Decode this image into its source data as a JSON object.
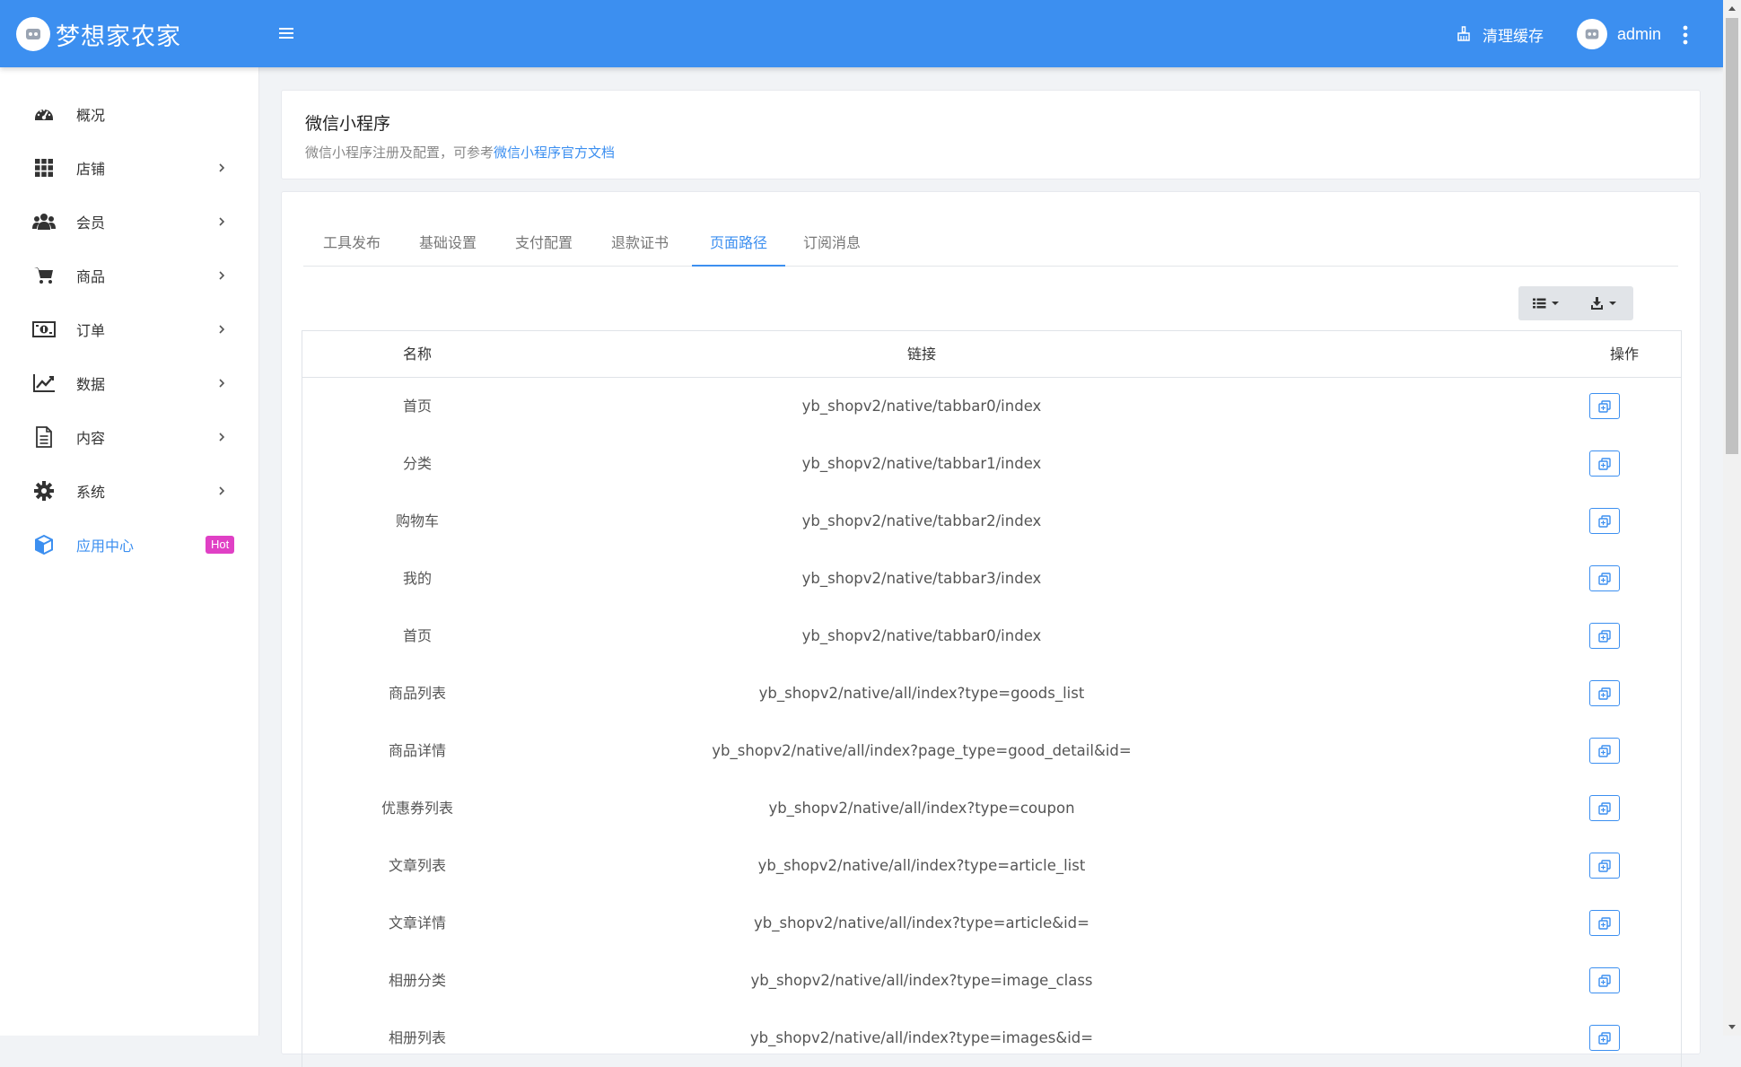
{
  "header": {
    "brand_title": "梦想家农家",
    "clear_cache_label": "清理缓存",
    "user_name": "admin",
    "accent_color": "#3c8ff0"
  },
  "sidebar": {
    "items": [
      {
        "label": "概况",
        "icon": "dashboard-icon"
      },
      {
        "label": "店铺",
        "icon": "grid-icon"
      },
      {
        "label": "会员",
        "icon": "users-icon"
      },
      {
        "label": "商品",
        "icon": "cart-icon"
      },
      {
        "label": "订单",
        "icon": "money-icon"
      },
      {
        "label": "数据",
        "icon": "chart-line-icon"
      },
      {
        "label": "内容",
        "icon": "document-icon"
      },
      {
        "label": "系统",
        "icon": "gear-icon"
      },
      {
        "label": "应用中心",
        "icon": "cube-icon",
        "badge": "Hot",
        "active": true
      }
    ]
  },
  "info": {
    "title": "微信小程序",
    "desc_prefix": "微信小程序注册及配置，可参考",
    "desc_link": "微信小程序官方文档"
  },
  "tabs": [
    {
      "label": "工具发布"
    },
    {
      "label": "基础设置"
    },
    {
      "label": "支付配置"
    },
    {
      "label": "退款证书"
    },
    {
      "label": "页面路径",
      "active": true
    },
    {
      "label": "订阅消息"
    }
  ],
  "table": {
    "headers": {
      "name": "名称",
      "link": "链接",
      "op": "操作"
    },
    "rows": [
      {
        "name": "首页",
        "link": "yb_shopv2/native/tabbar0/index"
      },
      {
        "name": "分类",
        "link": "yb_shopv2/native/tabbar1/index"
      },
      {
        "name": "购物车",
        "link": "yb_shopv2/native/tabbar2/index"
      },
      {
        "name": "我的",
        "link": "yb_shopv2/native/tabbar3/index"
      },
      {
        "name": "首页",
        "link": "yb_shopv2/native/tabbar0/index"
      },
      {
        "name": "商品列表",
        "link": "yb_shopv2/native/all/index?type=goods_list"
      },
      {
        "name": "商品详情",
        "link": "yb_shopv2/native/all/index?page_type=good_detail&id="
      },
      {
        "name": "优惠券列表",
        "link": "yb_shopv2/native/all/index?type=coupon"
      },
      {
        "name": "文章列表",
        "link": "yb_shopv2/native/all/index?type=article_list"
      },
      {
        "name": "文章详情",
        "link": "yb_shopv2/native/all/index?type=article&id="
      },
      {
        "name": "相册分类",
        "link": "yb_shopv2/native/all/index?type=image_class"
      },
      {
        "name": "相册列表",
        "link": "yb_shopv2/native/all/index?type=images&id="
      }
    ]
  }
}
